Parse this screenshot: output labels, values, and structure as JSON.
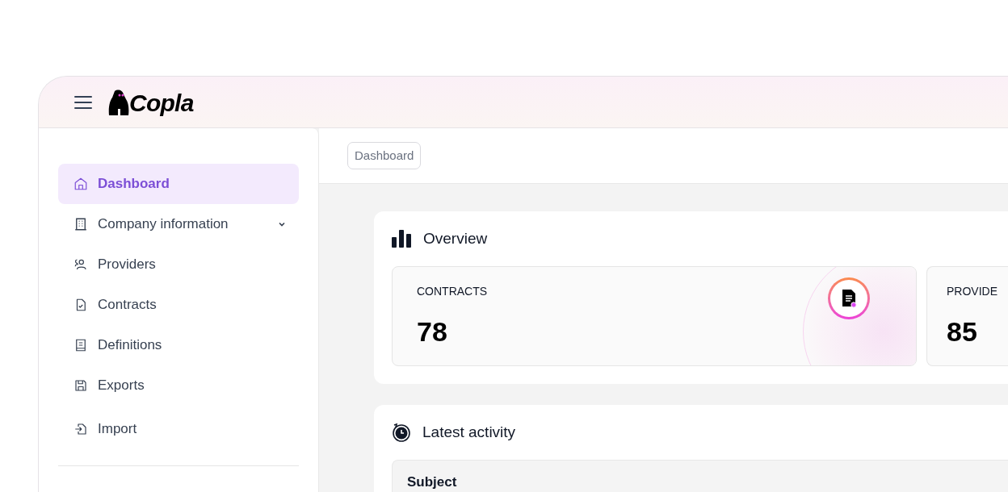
{
  "header": {
    "logo": "Copla"
  },
  "sidebar": {
    "items": [
      {
        "label": "Dashboard",
        "selected": true
      },
      {
        "label": "Company information",
        "selected": false,
        "expanded": false
      },
      {
        "label": "Providers",
        "selected": false
      },
      {
        "label": "Contracts",
        "selected": false
      },
      {
        "label": "Definitions",
        "selected": false
      },
      {
        "label": "Exports",
        "selected": false
      },
      {
        "label": "Import",
        "selected": false
      }
    ]
  },
  "breadcrumb": [
    "Dashboard"
  ],
  "overview": {
    "title": "Overview",
    "stats": [
      {
        "label": "CONTRACTS",
        "value": "78"
      },
      {
        "label": "PROVIDE",
        "value": "85"
      }
    ]
  },
  "activity": {
    "title": "Latest activity",
    "columns": [
      "Subject"
    ]
  }
}
